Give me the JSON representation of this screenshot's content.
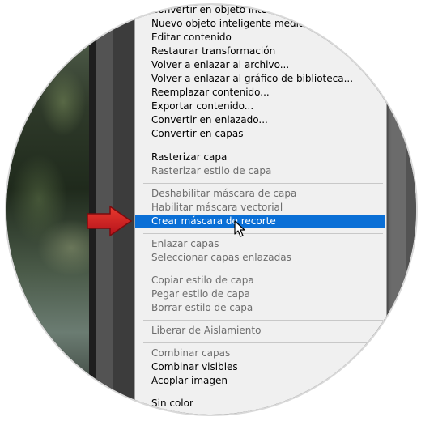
{
  "menu": {
    "items": [
      {
        "label": "Convertir en objeto inteligente",
        "enabled": true
      },
      {
        "label": "Nuevo objeto inteligente mediante copia",
        "enabled": true
      },
      {
        "label": "Editar contenido",
        "enabled": true
      },
      {
        "label": "Restaurar transformación",
        "enabled": true
      },
      {
        "label": "Volver a enlazar al archivo...",
        "enabled": true
      },
      {
        "label": "Volver a enlazar al gráfico de biblioteca...",
        "enabled": true
      },
      {
        "label": "Reemplazar contenido...",
        "enabled": true
      },
      {
        "label": "Exportar contenido...",
        "enabled": true
      },
      {
        "label": "Convertir en enlazado...",
        "enabled": true
      },
      {
        "label": "Convertir en capas",
        "enabled": true
      },
      {
        "label": "Rasterizar capa",
        "enabled": true
      },
      {
        "label": "Rasterizar estilo de capa",
        "enabled": false
      },
      {
        "label": "Deshabilitar máscara de capa",
        "enabled": false
      },
      {
        "label": "Habilitar máscara vectorial",
        "enabled": false
      },
      {
        "label": "Crear máscara de recorte",
        "enabled": true,
        "highlighted": true
      },
      {
        "label": "Enlazar capas",
        "enabled": false
      },
      {
        "label": "Seleccionar capas enlazadas",
        "enabled": false
      },
      {
        "label": "Copiar estilo de capa",
        "enabled": false
      },
      {
        "label": "Pegar estilo de capa",
        "enabled": false
      },
      {
        "label": "Borrar estilo de capa",
        "enabled": false
      },
      {
        "label": "Liberar de Aislamiento",
        "enabled": false
      },
      {
        "label": "Combinar capas",
        "enabled": false
      },
      {
        "label": "Combinar visibles",
        "enabled": true
      },
      {
        "label": "Acoplar imagen",
        "enabled": true
      },
      {
        "label": "Sin color",
        "enabled": true
      }
    ]
  },
  "colors": {
    "highlight": "#0a6fd6",
    "arrow": "#d7191c",
    "menu_bg": "#f0f0f0",
    "disabled_text": "#6d6d6d"
  },
  "icons": {
    "arrow": "red-arrow-pointer",
    "cursor": "mouse-cursor"
  }
}
